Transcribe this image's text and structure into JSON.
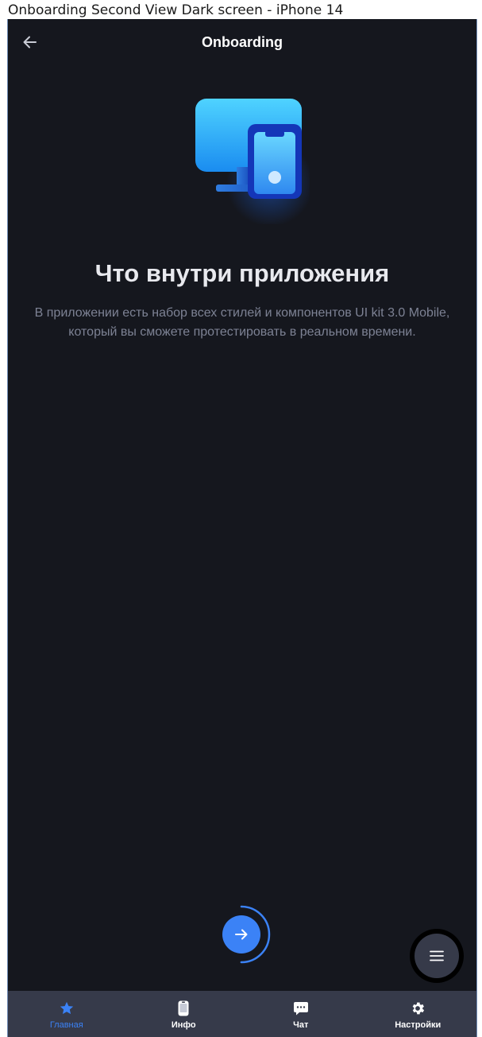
{
  "window": {
    "title": "Onboarding Second View Dark screen - iPhone 14"
  },
  "header": {
    "title": "Onboarding",
    "back_icon": "arrow-left-icon"
  },
  "onboarding": {
    "illustration_icon": "devices-icon",
    "title": "Что внутри приложения",
    "description": "В приложении есть набор всех стилей и компонентов UI kit 3.0 Mobile, который вы сможете протестировать в реальном времени.",
    "progress": 0.5,
    "next_icon": "arrow-right-icon"
  },
  "menu_fab": {
    "icon": "menu-icon"
  },
  "tabbar": {
    "items": [
      {
        "label": "Главная",
        "icon": "star-icon",
        "active": true
      },
      {
        "label": "Инфо",
        "icon": "phone-icon",
        "active": false
      },
      {
        "label": "Чат",
        "icon": "chat-icon",
        "active": false
      },
      {
        "label": "Настройки",
        "icon": "gear-icon",
        "active": false
      }
    ]
  },
  "colors": {
    "background": "#15171e",
    "accent": "#3b82f6",
    "tabbar": "#363a4a",
    "text_secondary": "#7d8294"
  }
}
